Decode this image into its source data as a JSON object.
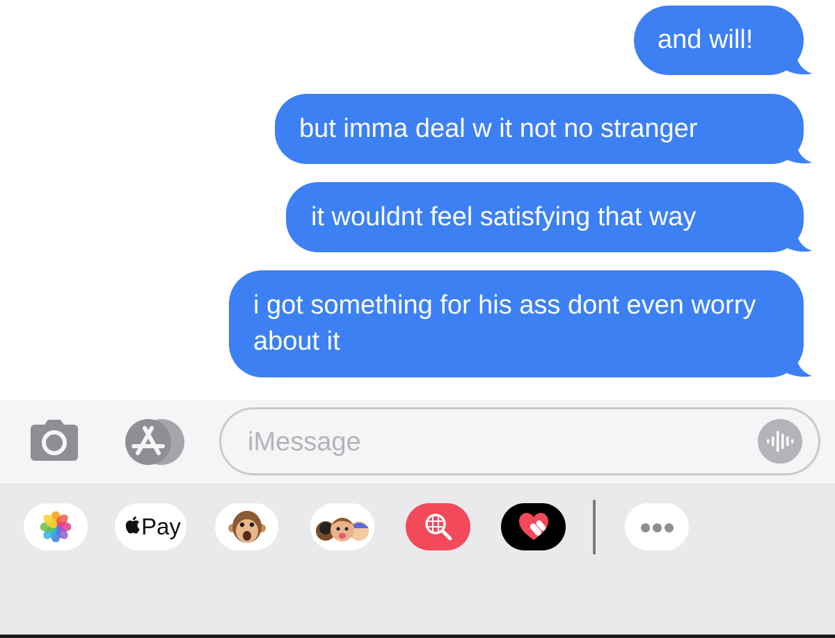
{
  "messages": [
    {
      "direction": "sent",
      "text": "and will!"
    },
    {
      "direction": "sent",
      "text": "but imma deal w it not no stranger"
    },
    {
      "direction": "sent",
      "text": "it wouldnt feel satisfying that way"
    },
    {
      "direction": "sent",
      "text": "i got something for his ass dont even worry about it"
    }
  ],
  "input": {
    "placeholder": "iMessage",
    "camera_icon": "camera-icon",
    "appstore_icon": "app-store-icon",
    "audio_icon": "audio-waveform-icon"
  },
  "app_drawer": {
    "items": [
      {
        "icon": "photos-icon",
        "label": ""
      },
      {
        "icon": "apple-pay-icon",
        "label": "Pay"
      },
      {
        "icon": "animoji-icon",
        "label": ""
      },
      {
        "icon": "memoji-stickers-icon",
        "label": ""
      },
      {
        "icon": "images-search-icon",
        "label": ""
      },
      {
        "icon": "digital-touch-icon",
        "label": ""
      },
      {
        "icon": "more-apps-icon",
        "label": ""
      }
    ]
  },
  "colors": {
    "sent_bubble": "#3c80f4",
    "bubble_text": "#ffffff",
    "input_background": "#f5f5f7",
    "drawer_background": "#eaeaed",
    "placeholder_text": "#b3b3b8",
    "search_app": "#f2495b",
    "digital_touch_app": "#000000"
  }
}
